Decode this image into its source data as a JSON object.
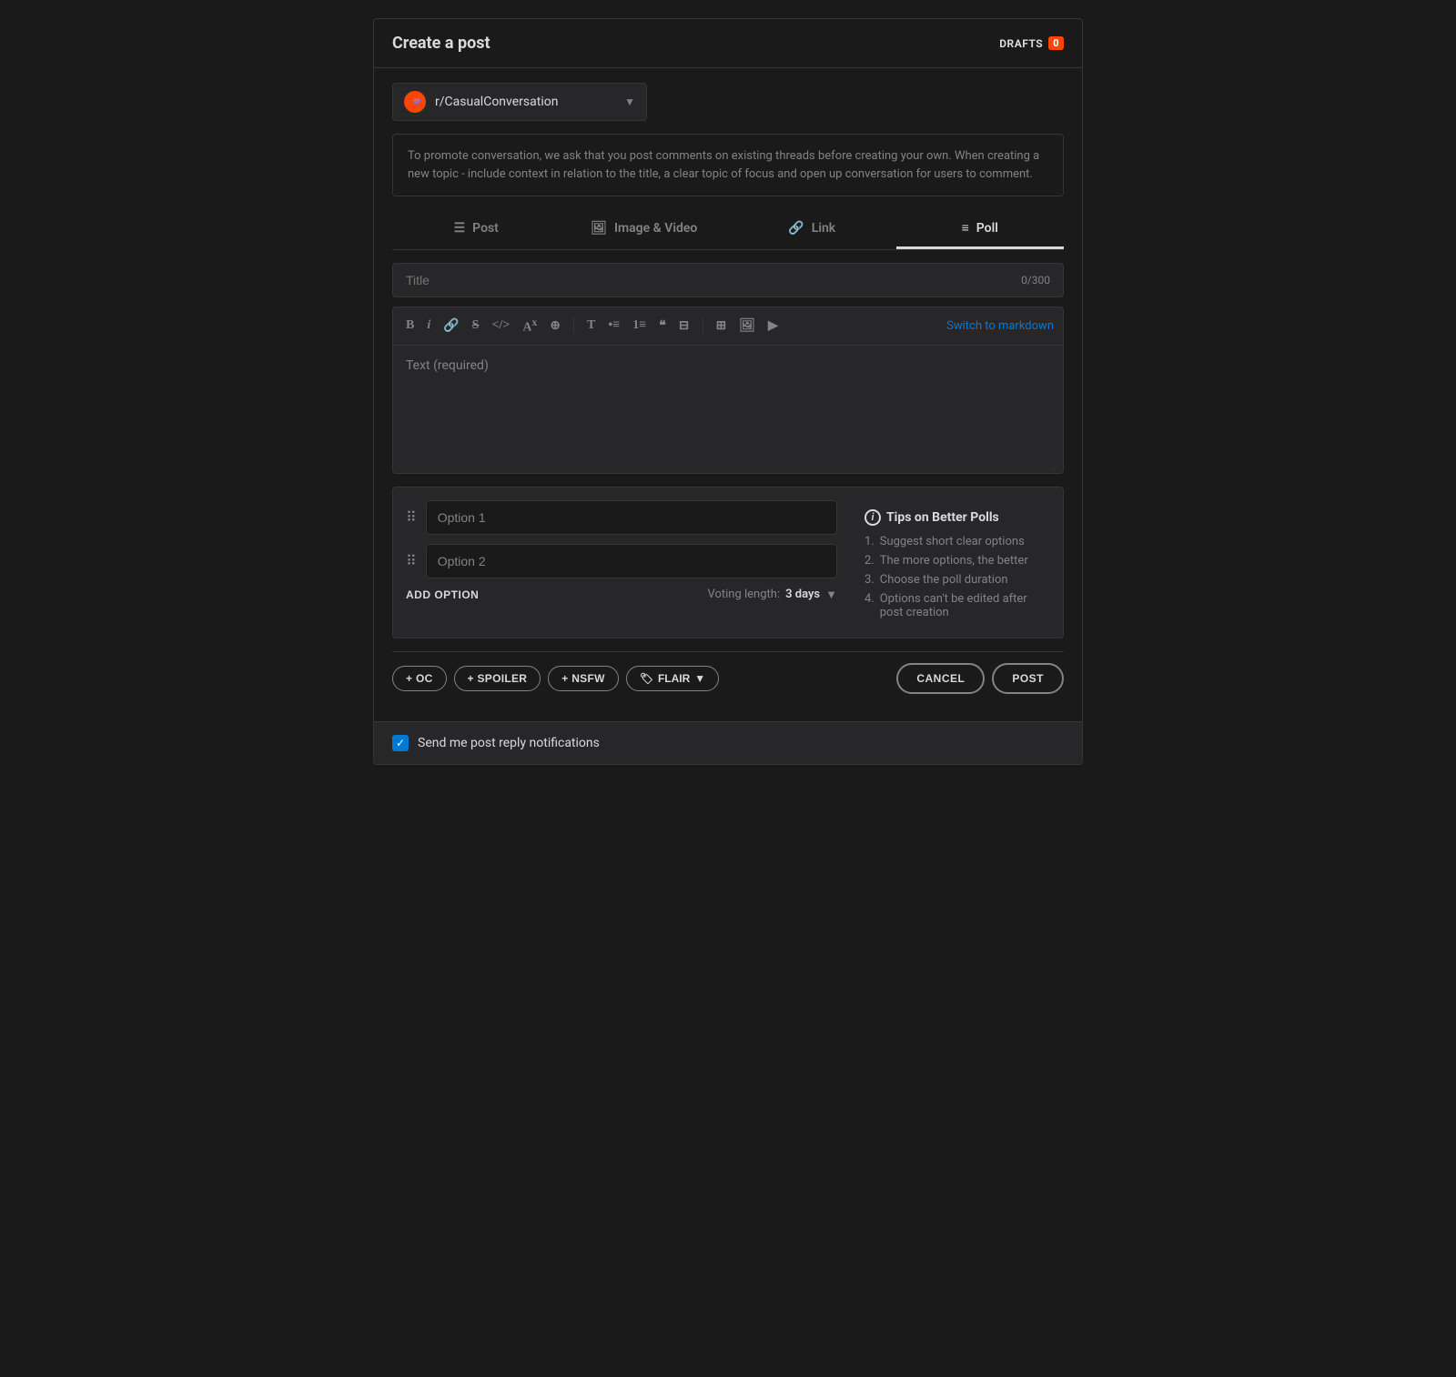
{
  "header": {
    "title": "Create a post",
    "drafts_label": "DRAFTS",
    "drafts_count": "0"
  },
  "subreddit": {
    "name": "r/CasualConversation"
  },
  "notice": {
    "text": "To promote conversation, we ask that you post comments on existing threads before creating your own. When creating a new topic - include context in relation to the title, a clear topic of focus and open up conversation for users to comment."
  },
  "tabs": [
    {
      "label": "Post",
      "icon": "post-icon",
      "active": false
    },
    {
      "label": "Image & Video",
      "icon": "image-icon",
      "active": false
    },
    {
      "label": "Link",
      "icon": "link-icon",
      "active": false
    },
    {
      "label": "Poll",
      "icon": "poll-icon",
      "active": true
    }
  ],
  "title_input": {
    "placeholder": "Title",
    "count": "0/300"
  },
  "editor": {
    "placeholder": "Text (required)",
    "switch_label": "Switch to markdown",
    "toolbar": {
      "bold": "B",
      "italic": "i",
      "link": "🔗",
      "strikethrough": "S",
      "code": "</>",
      "superscript": "A",
      "heading": "T",
      "bullet_list": "≡",
      "numbered_list": "≡",
      "quote": "❝",
      "table": "⊞"
    }
  },
  "poll": {
    "option1_placeholder": "Option 1",
    "option2_placeholder": "Option 2",
    "add_option_label": "ADD OPTION",
    "voting_length_label": "Voting length:",
    "voting_length_value": "3 days",
    "tips": {
      "title": "Tips on Better Polls",
      "items": [
        "Suggest short clear options",
        "The more options, the better",
        "Choose the poll duration",
        "Options can't be edited after post creation"
      ]
    }
  },
  "actions": {
    "oc_label": "+ OC",
    "spoiler_label": "+ SPOILER",
    "nsfw_label": "+ NSFW",
    "flair_label": "FLAIR",
    "cancel_label": "CANCEL",
    "post_label": "POST"
  },
  "notification": {
    "label": "Send me post reply notifications",
    "checked": true
  }
}
